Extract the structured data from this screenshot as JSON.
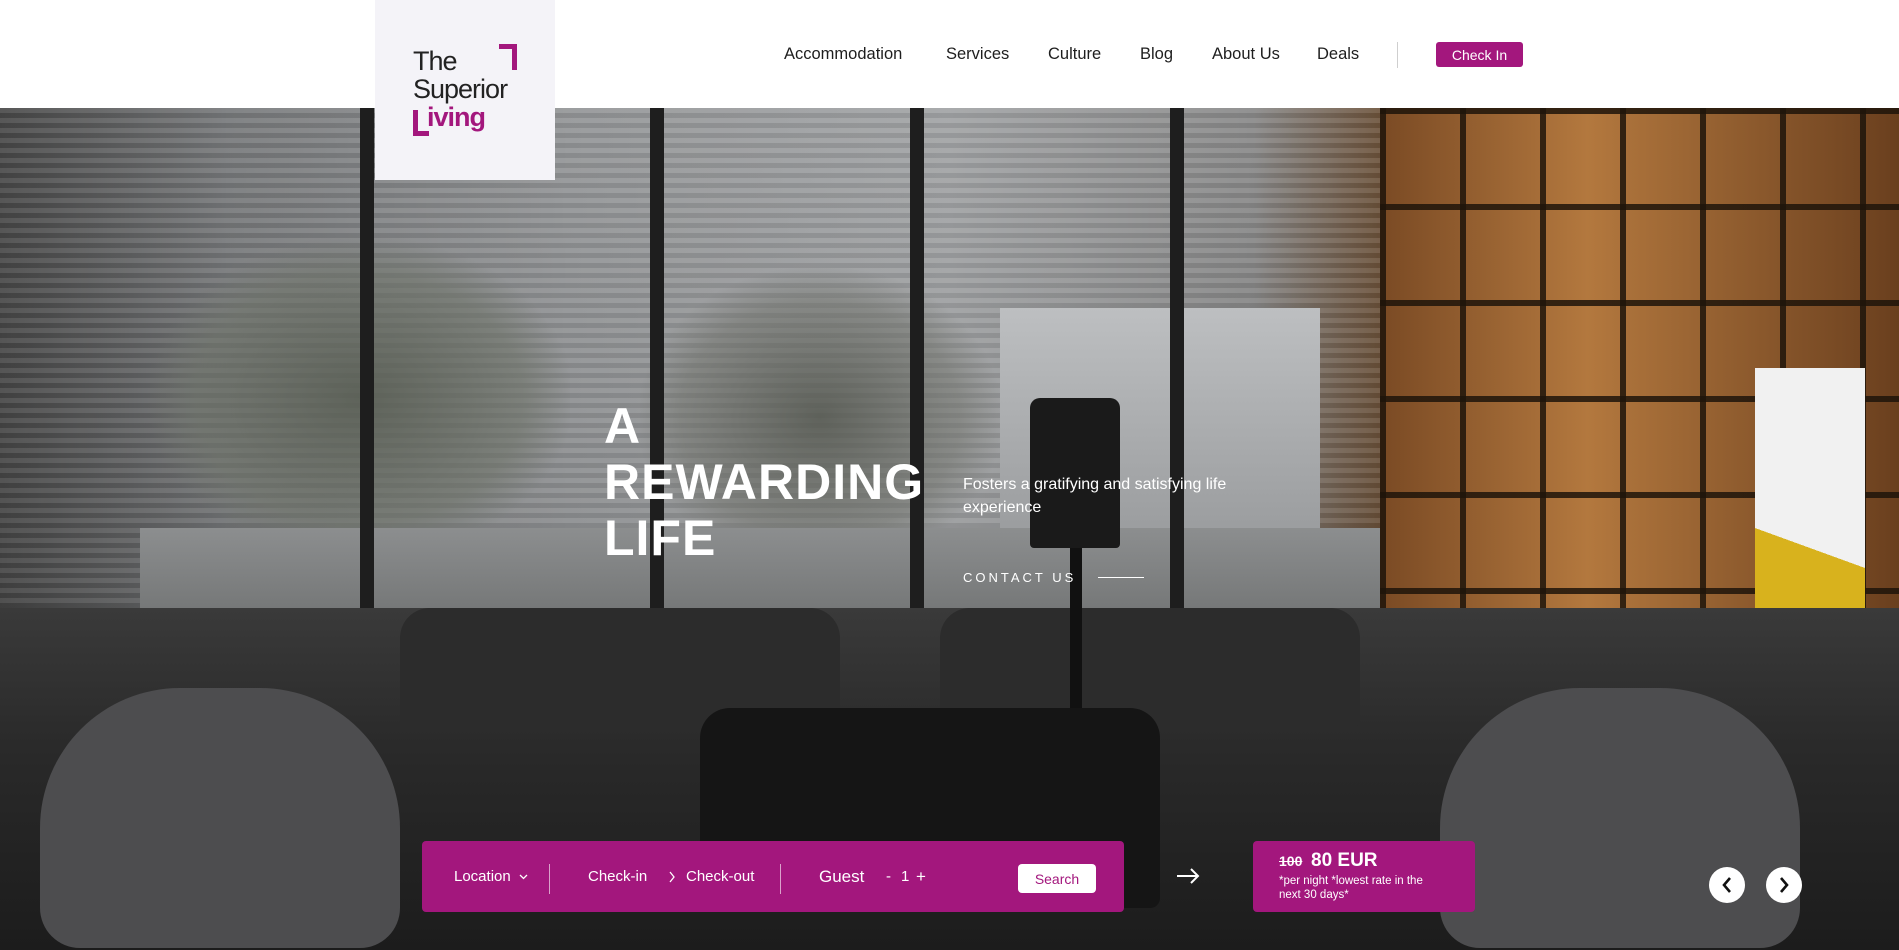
{
  "brand": {
    "line1": "The",
    "line2": "Superior",
    "line3": "iving",
    "accent_color": "#a3177d"
  },
  "nav": {
    "items": [
      {
        "label": "Accommodation"
      },
      {
        "label": "Services"
      },
      {
        "label": "Culture"
      },
      {
        "label": "Blog"
      },
      {
        "label": "About Us"
      },
      {
        "label": "Deals"
      }
    ],
    "checkin_label": "Check In"
  },
  "hero": {
    "title_line1": "A",
    "title_line2": "REWARDING",
    "title_line3": "LIFE",
    "subtitle": "Fosters a gratifying and satisfying life experience",
    "contact_label": "CONTACT US"
  },
  "booking": {
    "location_label": "Location",
    "checkin_label": "Check-in",
    "checkout_label": "Check-out",
    "guest_label": "Guest",
    "minus": "-",
    "guest_count": "1",
    "plus": "+",
    "search_label": "Search"
  },
  "price": {
    "old_price": "100",
    "new_price": "80 EUR",
    "note": "*per night *lowest rate in the next 30 days*"
  },
  "icons": {
    "arrow_next": "arrow-right-icon",
    "prev": "chevron-left-icon",
    "next": "chevron-right-icon"
  }
}
